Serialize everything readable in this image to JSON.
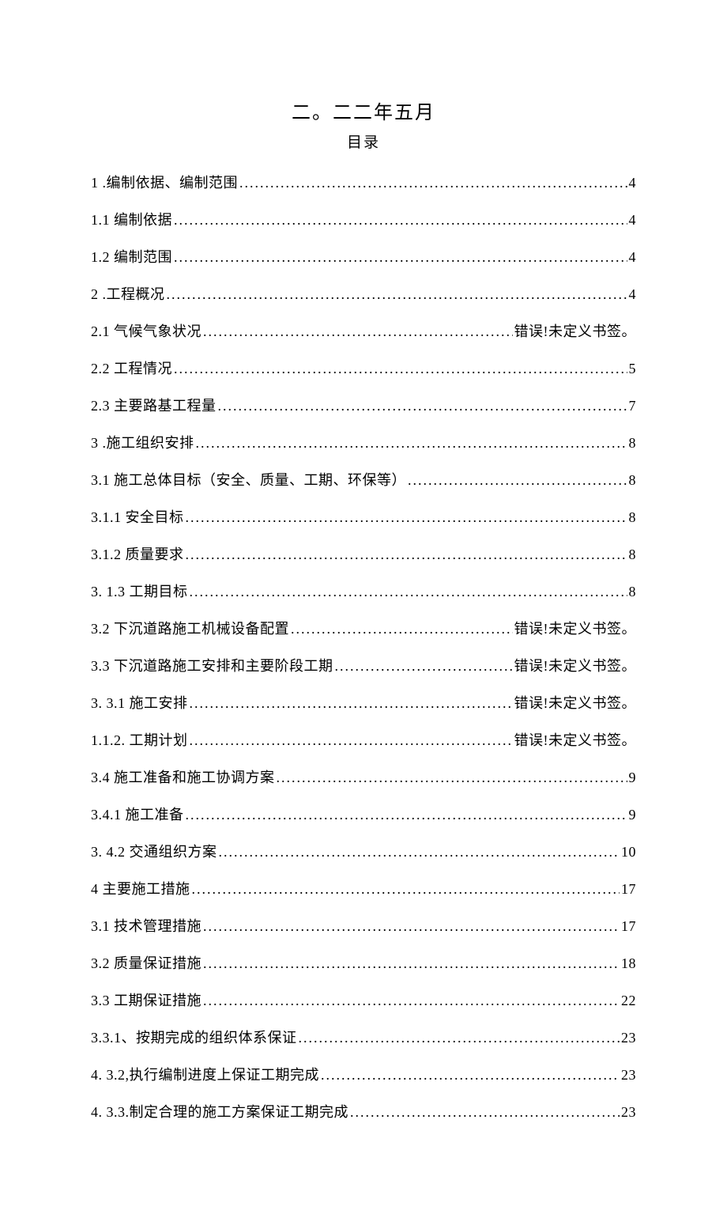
{
  "title": "二。二二年五月",
  "subtitle": "目录",
  "toc": [
    {
      "label": "1 .编制依据、编制范围",
      "page": "4"
    },
    {
      "label": "1.1 编制依据 ",
      "page": "4"
    },
    {
      "label": "1.2 编制范围 ",
      "page": "4"
    },
    {
      "label": "2 .工程概况 ",
      "page": "4"
    },
    {
      "label": "2.1 气候气象状况",
      "page": "错误!未定义书签。"
    },
    {
      "label": "2.2 工程情况 ",
      "page": "5"
    },
    {
      "label": "2.3 主要路基工程量 ",
      "page": "7"
    },
    {
      "label": "3 .施工组织安排 ",
      "page": "8"
    },
    {
      "label": "3.1 施工总体目标（安全、质量、工期、环保等） ",
      "page": "8"
    },
    {
      "label": "3.1.1 安全目标",
      "page": "8"
    },
    {
      "label": "3.1.2 质量要求",
      "page": "8"
    },
    {
      "label": "3. 1.3 工期目标 ",
      "page": "8"
    },
    {
      "label": "3.2 下沉道路施工机械设备配置",
      "page": "错误!未定义书签。"
    },
    {
      "label": "3.3 下沉道路施工安排和主要阶段工期",
      "page": "错误!未定义书签。"
    },
    {
      "label": "3. 3.1 施工安排",
      "page": "错误!未定义书签。"
    },
    {
      "label": "1.1.2. 工期计划",
      "page": "错误!未定义书签。"
    },
    {
      "label": "3.4 施工准备和施工协调方案 ",
      "page": "9"
    },
    {
      "label": "3.4.1 施工准备",
      "page": "9"
    },
    {
      "label": "3. 4.2 交通组织方案",
      "page": "10"
    },
    {
      "label": "4 主要施工措施 ",
      "page": "17"
    },
    {
      "label": "3.1 技术管理措施 ",
      "page": "17"
    },
    {
      "label": "3.2 质量保证措施",
      "page": "18"
    },
    {
      "label": "3.3 工期保证措施",
      "page": "22"
    },
    {
      "label": "3.3.1、按期完成的组织体系保证",
      "page": "23"
    },
    {
      "label": "4. 3.2,执行编制进度上保证工期完成 ",
      "page": "23"
    },
    {
      "label": "4. 3.3.制定合理的施工方案保证工期完成 ",
      "page": "23"
    }
  ]
}
